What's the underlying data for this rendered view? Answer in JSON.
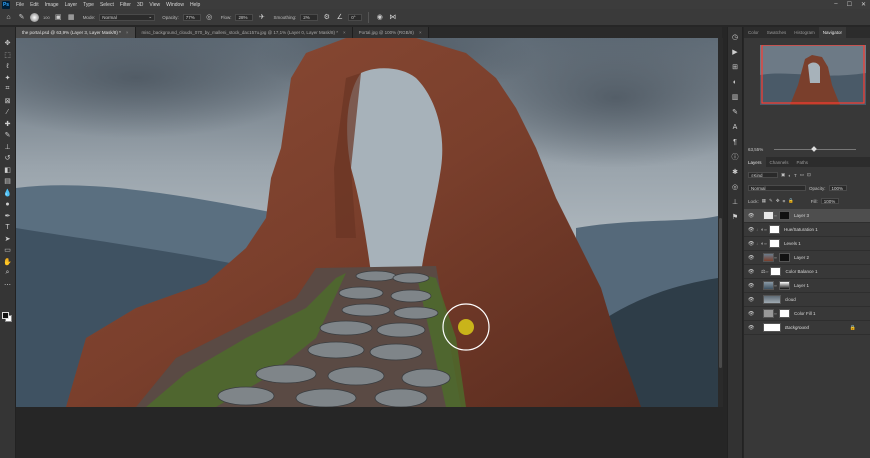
{
  "menu": {
    "items": [
      "File",
      "Edit",
      "Image",
      "Layer",
      "Type",
      "Select",
      "Filter",
      "3D",
      "View",
      "Window",
      "Help"
    ]
  },
  "options": {
    "mode_label": "Mode:",
    "mode_value": "Normal",
    "opacity_label": "Opacity:",
    "opacity_value": "77%",
    "flow_label": "Flow:",
    "flow_value": "28%",
    "smoothing_label": "Smoothing:",
    "smoothing_value": "2%",
    "angle_value": "0°",
    "brush_size": "100"
  },
  "tabs": [
    {
      "label": "the portal.psd @ 63,9% (Layer 3, Layer Mask/8) *",
      "active": true
    },
    {
      "label": "misc_background_clouds_070_by_malleni_stock_dac157u.jpg @ 17,1% (Layer 0, Layer Mask/8) *",
      "active": false
    },
    {
      "label": "Portal.jpg @ 100% (RGB/8)",
      "active": false
    }
  ],
  "panel_tabs": [
    "Color",
    "Swatches",
    "Histogram",
    "Navigator"
  ],
  "navigator": {
    "zoom": "63,55%"
  },
  "layers_tabs": [
    "Layers",
    "Channels",
    "Paths"
  ],
  "layers_controls": {
    "kind": "Kind",
    "blend": "Normal",
    "opacity_label": "Opacity:",
    "opacity_value": "100%",
    "lock_label": "Lock:",
    "fill_label": "Fill:",
    "fill_value": "100%"
  },
  "layers": [
    {
      "name": "Layer 3",
      "selected": true,
      "thumb": "mask"
    },
    {
      "name": "Hue/Saturation 1",
      "selected": false,
      "thumb": "white"
    },
    {
      "name": "Levels 1",
      "selected": false,
      "thumb": "white"
    },
    {
      "name": "Layer 2",
      "selected": false,
      "thumb": "photo"
    },
    {
      "name": "Color Balance 1",
      "selected": false,
      "thumb": "white"
    },
    {
      "name": "Layer 1",
      "selected": false,
      "thumb": "mountains"
    },
    {
      "name": "cloud",
      "selected": false,
      "thumb": "clouds"
    },
    {
      "name": "Color Fill 1",
      "selected": false,
      "thumb": "white"
    },
    {
      "name": "Background",
      "selected": false,
      "thumb": "white",
      "locked": true
    }
  ],
  "colors": {
    "menubar": "#3c3c3c",
    "sky": "#7e8a94",
    "rock": "#7b4030",
    "brush_cursor": "#c9b41a"
  }
}
